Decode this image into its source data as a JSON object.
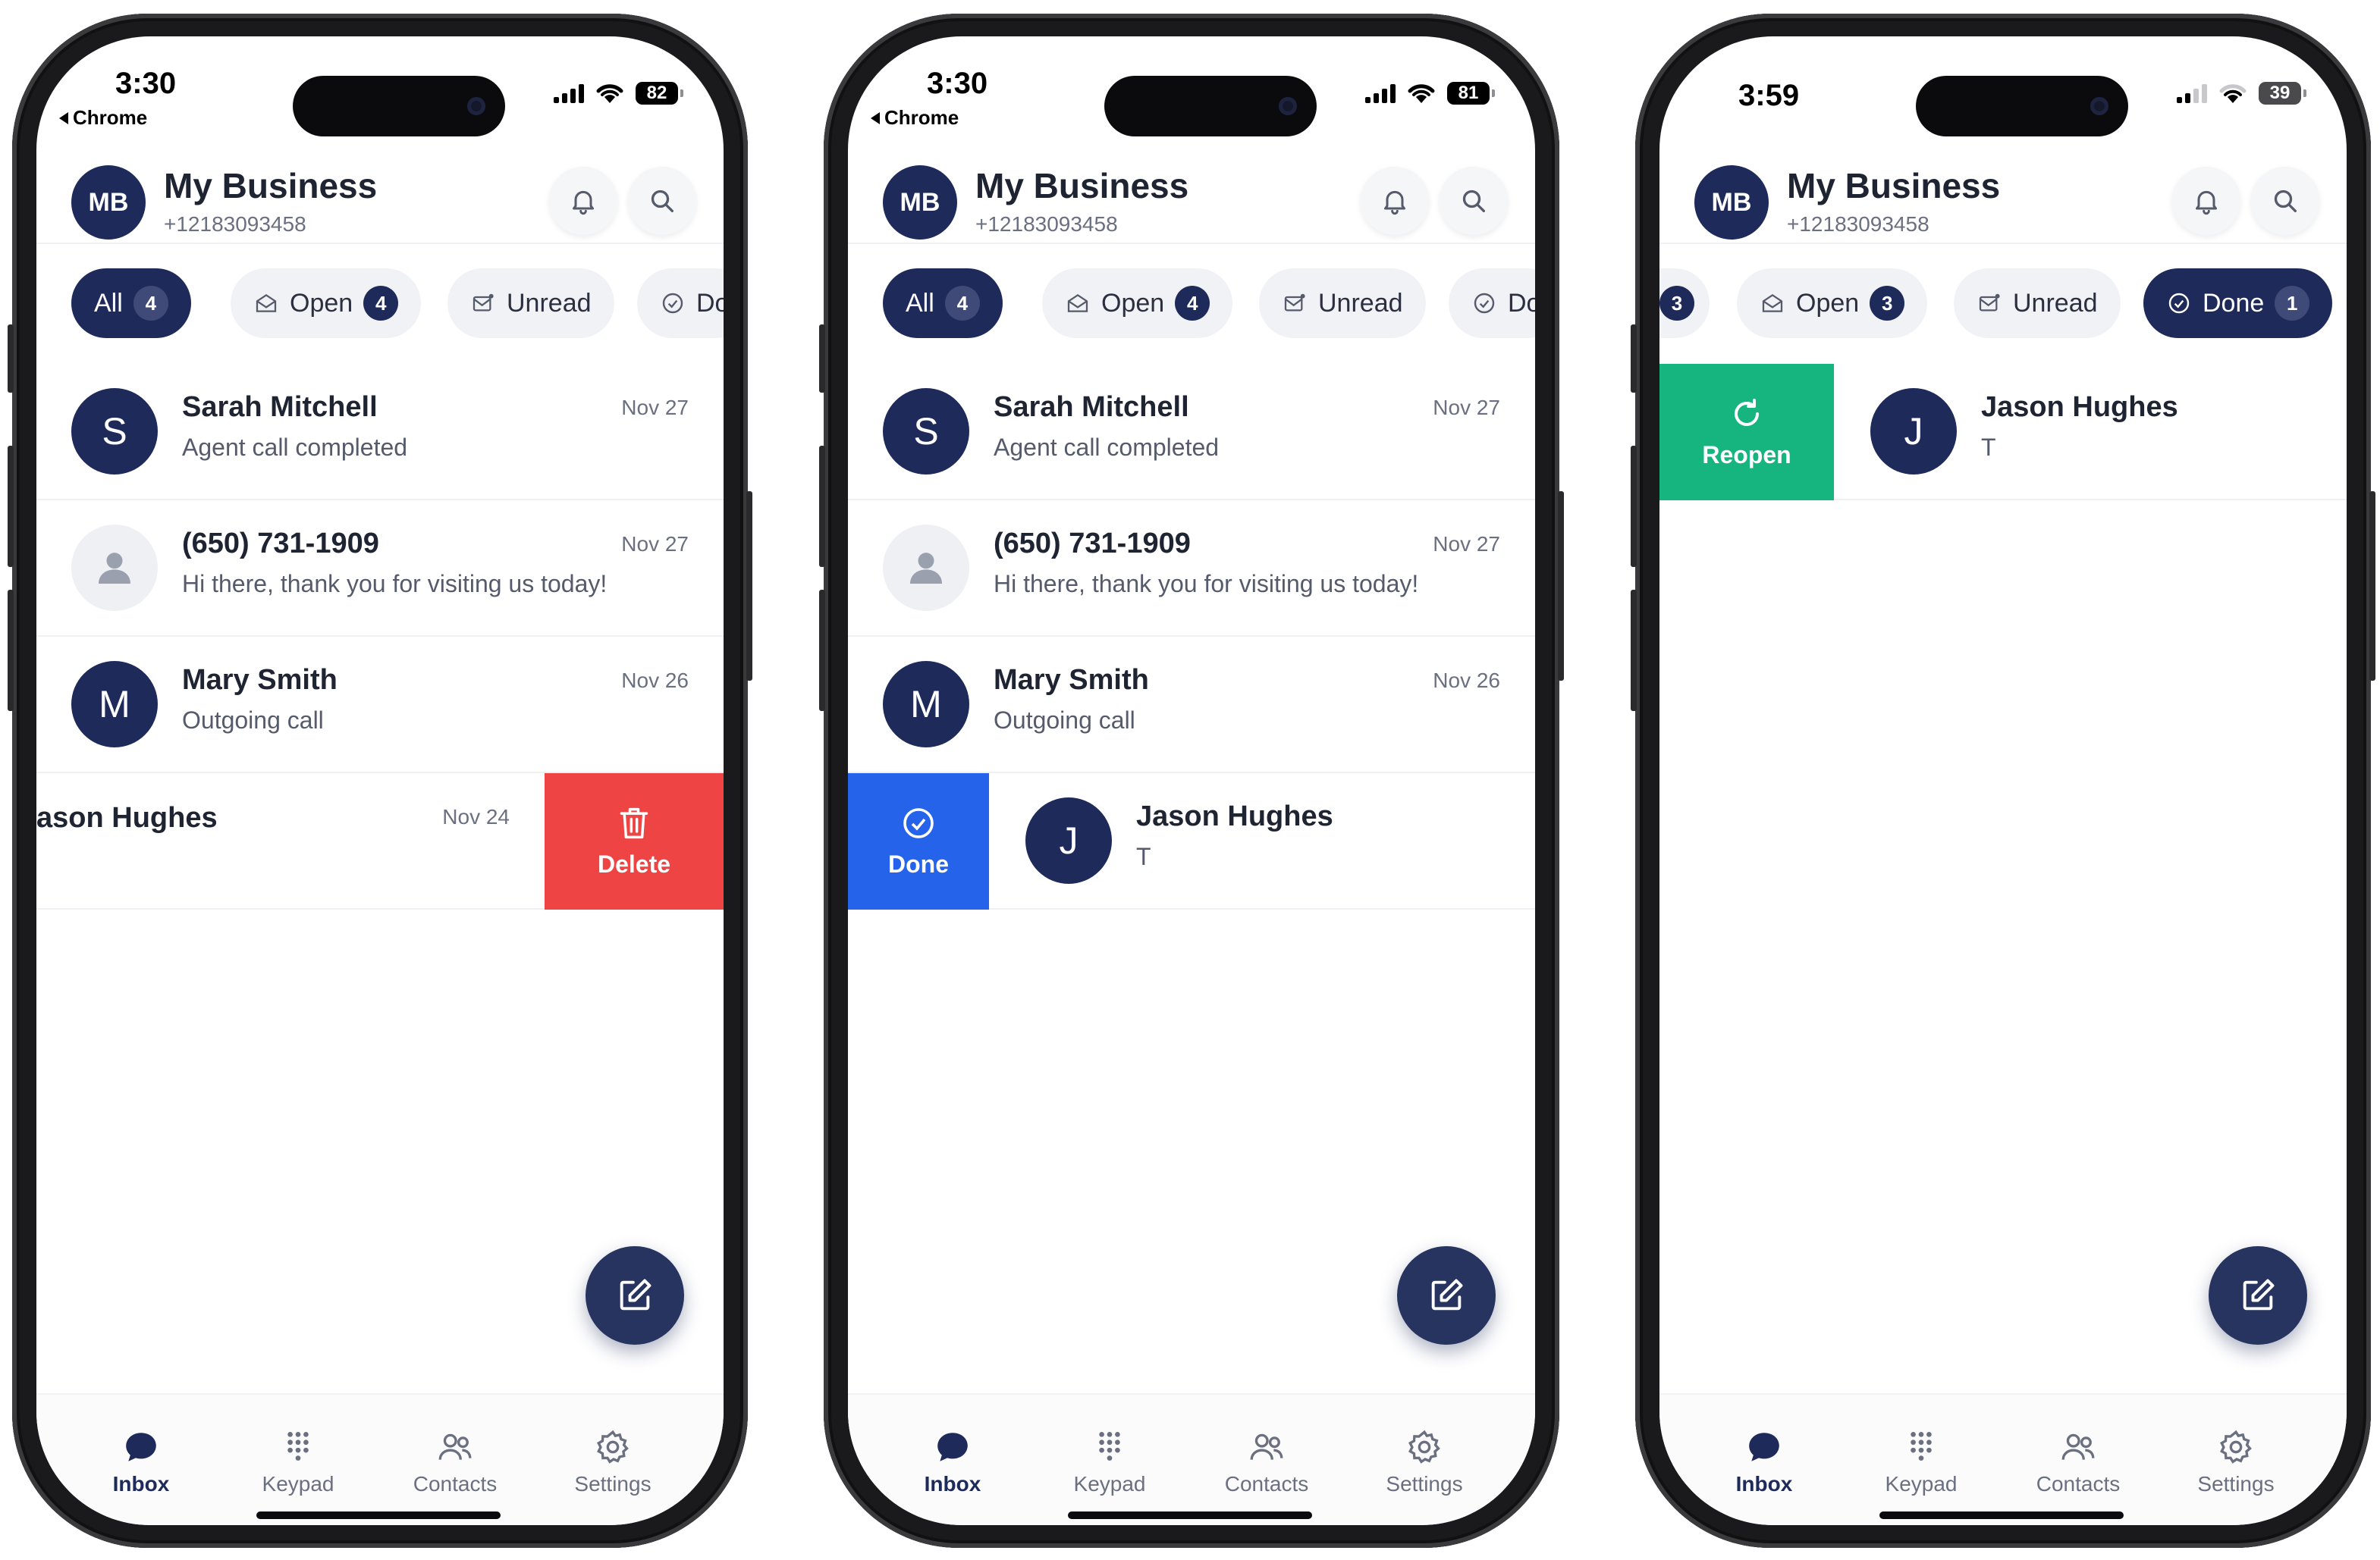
{
  "screens": [
    {
      "status": {
        "time": "3:30",
        "back_app": "Chrome",
        "battery": "82"
      },
      "header": {
        "avatar": "MB",
        "title": "My Business",
        "phone": "+12183093458"
      },
      "chips": [
        {
          "label": "All",
          "count": "4",
          "active": true
        },
        {
          "label": "Open",
          "count": "4"
        },
        {
          "label": "Unread"
        },
        {
          "label": "Do"
        }
      ],
      "rows": [
        {
          "avatar": "S",
          "name": "Sarah Mitchell",
          "preview": "Agent call completed",
          "date": "Nov 27"
        },
        {
          "avatar": "",
          "name": "(650) 731-1909",
          "preview": "Hi there, thank you for visiting us today!",
          "date": "Nov 27"
        },
        {
          "avatar": "M",
          "name": "Mary Smith",
          "preview": "Outgoing call",
          "date": "Nov 26"
        },
        {
          "avatar": "",
          "name": "ason Hughes",
          "preview": "",
          "date": "Nov 24",
          "action": "Delete"
        }
      ],
      "tabs": [
        "Inbox",
        "Keypad",
        "Contacts",
        "Settings"
      ]
    },
    {
      "status": {
        "time": "3:30",
        "back_app": "Chrome",
        "battery": "81"
      },
      "header": {
        "avatar": "MB",
        "title": "My Business",
        "phone": "+12183093458"
      },
      "chips": [
        {
          "label": "All",
          "count": "4",
          "active": true
        },
        {
          "label": "Open",
          "count": "4"
        },
        {
          "label": "Unread"
        },
        {
          "label": "Do"
        }
      ],
      "rows": [
        {
          "avatar": "S",
          "name": "Sarah Mitchell",
          "preview": "Agent call completed",
          "date": "Nov 27"
        },
        {
          "avatar": "",
          "name": "(650) 731-1909",
          "preview": "Hi there, thank you for visiting us today!",
          "date": "Nov 27"
        },
        {
          "avatar": "M",
          "name": "Mary Smith",
          "preview": "Outgoing call",
          "date": "Nov 26"
        },
        {
          "avatar": "J",
          "name": "Jason Hughes",
          "preview": "T",
          "date": "",
          "action": "Done"
        }
      ],
      "tabs": [
        "Inbox",
        "Keypad",
        "Contacts",
        "Settings"
      ]
    },
    {
      "status": {
        "time": "3:59",
        "battery": "39"
      },
      "header": {
        "avatar": "MB",
        "title": "My Business",
        "phone": "+12183093458"
      },
      "chips": [
        {
          "count": "3"
        },
        {
          "label": "Open",
          "count": "3"
        },
        {
          "label": "Unread"
        },
        {
          "label": "Done",
          "count": "1",
          "active": true
        }
      ],
      "rows": [
        {
          "avatar": "J",
          "name": "Jason Hughes",
          "preview": "T",
          "action": "Reopen"
        }
      ],
      "tabs": [
        "Inbox",
        "Keypad",
        "Contacts",
        "Settings"
      ]
    }
  ],
  "colors": {
    "navy": "#1e2a5a",
    "delete": "#ef4444",
    "done": "#2563eb",
    "reopen": "#16b47e"
  }
}
